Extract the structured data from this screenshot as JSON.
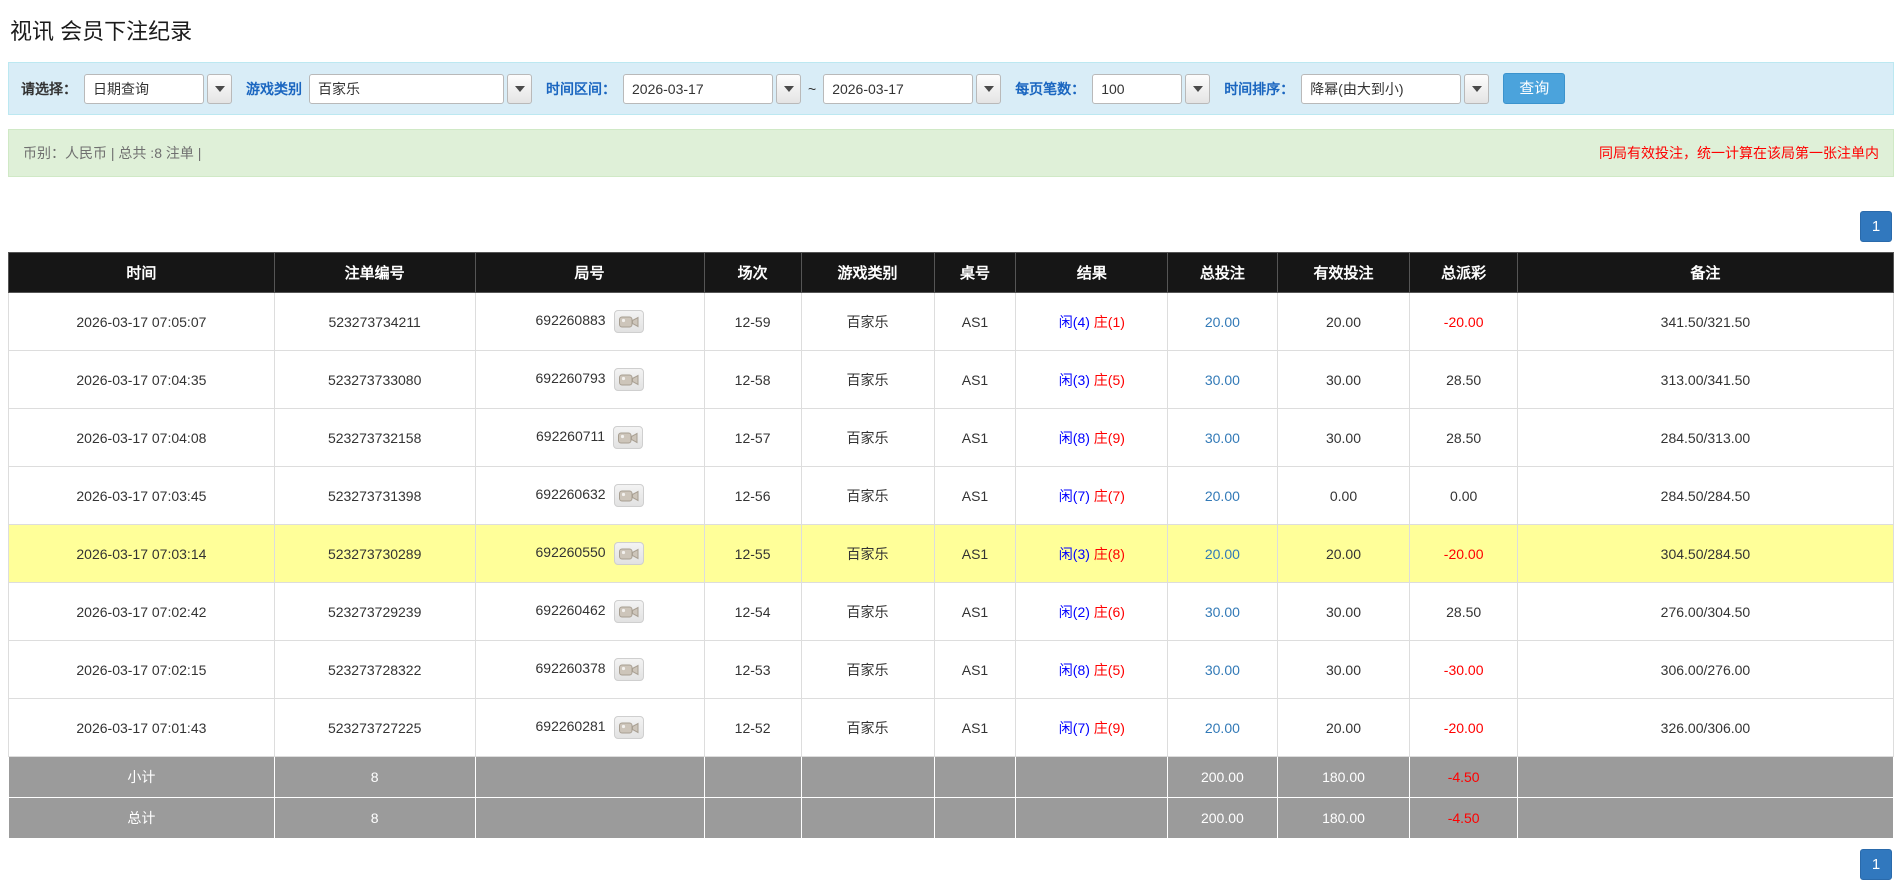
{
  "page": {
    "title": "视讯 会员下注纪录"
  },
  "colors": {
    "accent_blue": "#337ab7",
    "highlight_yellow": "#ffff99",
    "negative_red": "#ff0000",
    "player_blue": "#0000ff",
    "banker_red": "#ff0000",
    "filter_bar_bg": "#d9edf7",
    "summary_bar_bg": "#dff0d8",
    "header_bg": "#161616",
    "footer_bg": "#9b9b9b"
  },
  "filters": {
    "select_label": "请选择：",
    "select_value": "日期查询",
    "game_type_label": "游戏类别",
    "game_type_value": "百家乐",
    "time_range_label": "时间区间：",
    "date_from": "2026-03-17",
    "tilde": "~",
    "date_to": "2026-03-17",
    "page_size_label": "每页笔数：",
    "page_size_value": "100",
    "sort_label": "时间排序：",
    "sort_value": "降幂(由大到小)",
    "search_button": "查询"
  },
  "summary": {
    "left": "币别：人民币 | 总共 :8 注单 |",
    "right": "同局有效投注，统一计算在该局第一张注单内"
  },
  "pagination": {
    "page": "1"
  },
  "table": {
    "headers": [
      "时间",
      "注单编号",
      "局号",
      "场次",
      "游戏类别",
      "桌号",
      "结果",
      "总投注",
      "有效投注",
      "总派彩",
      "备注"
    ],
    "rows": [
      {
        "time": "2026-03-17 07:05:07",
        "bet_id": "523273734211",
        "round_id": "692260883",
        "session": "12-59",
        "game": "百家乐",
        "table_no": "AS1",
        "result_player": "闲(4)",
        "result_banker": "庄(1)",
        "total_bet": "20.00",
        "valid_bet": "20.00",
        "payout": "-20.00",
        "remark": "341.50/321.50",
        "highlight": false
      },
      {
        "time": "2026-03-17 07:04:35",
        "bet_id": "523273733080",
        "round_id": "692260793",
        "session": "12-58",
        "game": "百家乐",
        "table_no": "AS1",
        "result_player": "闲(3)",
        "result_banker": "庄(5)",
        "total_bet": "30.00",
        "valid_bet": "30.00",
        "payout": "28.50",
        "remark": "313.00/341.50",
        "highlight": false
      },
      {
        "time": "2026-03-17 07:04:08",
        "bet_id": "523273732158",
        "round_id": "692260711",
        "session": "12-57",
        "game": "百家乐",
        "table_no": "AS1",
        "result_player": "闲(8)",
        "result_banker": "庄(9)",
        "total_bet": "30.00",
        "valid_bet": "30.00",
        "payout": "28.50",
        "remark": "284.50/313.00",
        "highlight": false
      },
      {
        "time": "2026-03-17 07:03:45",
        "bet_id": "523273731398",
        "round_id": "692260632",
        "session": "12-56",
        "game": "百家乐",
        "table_no": "AS1",
        "result_player": "闲(7)",
        "result_banker": "庄(7)",
        "total_bet": "20.00",
        "valid_bet": "0.00",
        "payout": "0.00",
        "remark": "284.50/284.50",
        "highlight": false
      },
      {
        "time": "2026-03-17 07:03:14",
        "bet_id": "523273730289",
        "round_id": "692260550",
        "session": "12-55",
        "game": "百家乐",
        "table_no": "AS1",
        "result_player": "闲(3)",
        "result_banker": "庄(8)",
        "total_bet": "20.00",
        "valid_bet": "20.00",
        "payout": "-20.00",
        "remark": "304.50/284.50",
        "highlight": true
      },
      {
        "time": "2026-03-17 07:02:42",
        "bet_id": "523273729239",
        "round_id": "692260462",
        "session": "12-54",
        "game": "百家乐",
        "table_no": "AS1",
        "result_player": "闲(2)",
        "result_banker": "庄(6)",
        "total_bet": "30.00",
        "valid_bet": "30.00",
        "payout": "28.50",
        "remark": "276.00/304.50",
        "highlight": false
      },
      {
        "time": "2026-03-17 07:02:15",
        "bet_id": "523273728322",
        "round_id": "692260378",
        "session": "12-53",
        "game": "百家乐",
        "table_no": "AS1",
        "result_player": "闲(8)",
        "result_banker": "庄(5)",
        "total_bet": "30.00",
        "valid_bet": "30.00",
        "payout": "-30.00",
        "remark": "306.00/276.00",
        "highlight": false
      },
      {
        "time": "2026-03-17 07:01:43",
        "bet_id": "523273727225",
        "round_id": "692260281",
        "session": "12-52",
        "game": "百家乐",
        "table_no": "AS1",
        "result_player": "闲(7)",
        "result_banker": "庄(9)",
        "total_bet": "20.00",
        "valid_bet": "20.00",
        "payout": "-20.00",
        "remark": "326.00/306.00",
        "highlight": false
      }
    ],
    "subtotal": {
      "label": "小计",
      "count": "8",
      "total_bet": "200.00",
      "valid_bet": "180.00",
      "payout": "-4.50"
    },
    "total": {
      "label": "总计",
      "count": "8",
      "total_bet": "200.00",
      "valid_bet": "180.00",
      "payout": "-4.50"
    }
  }
}
